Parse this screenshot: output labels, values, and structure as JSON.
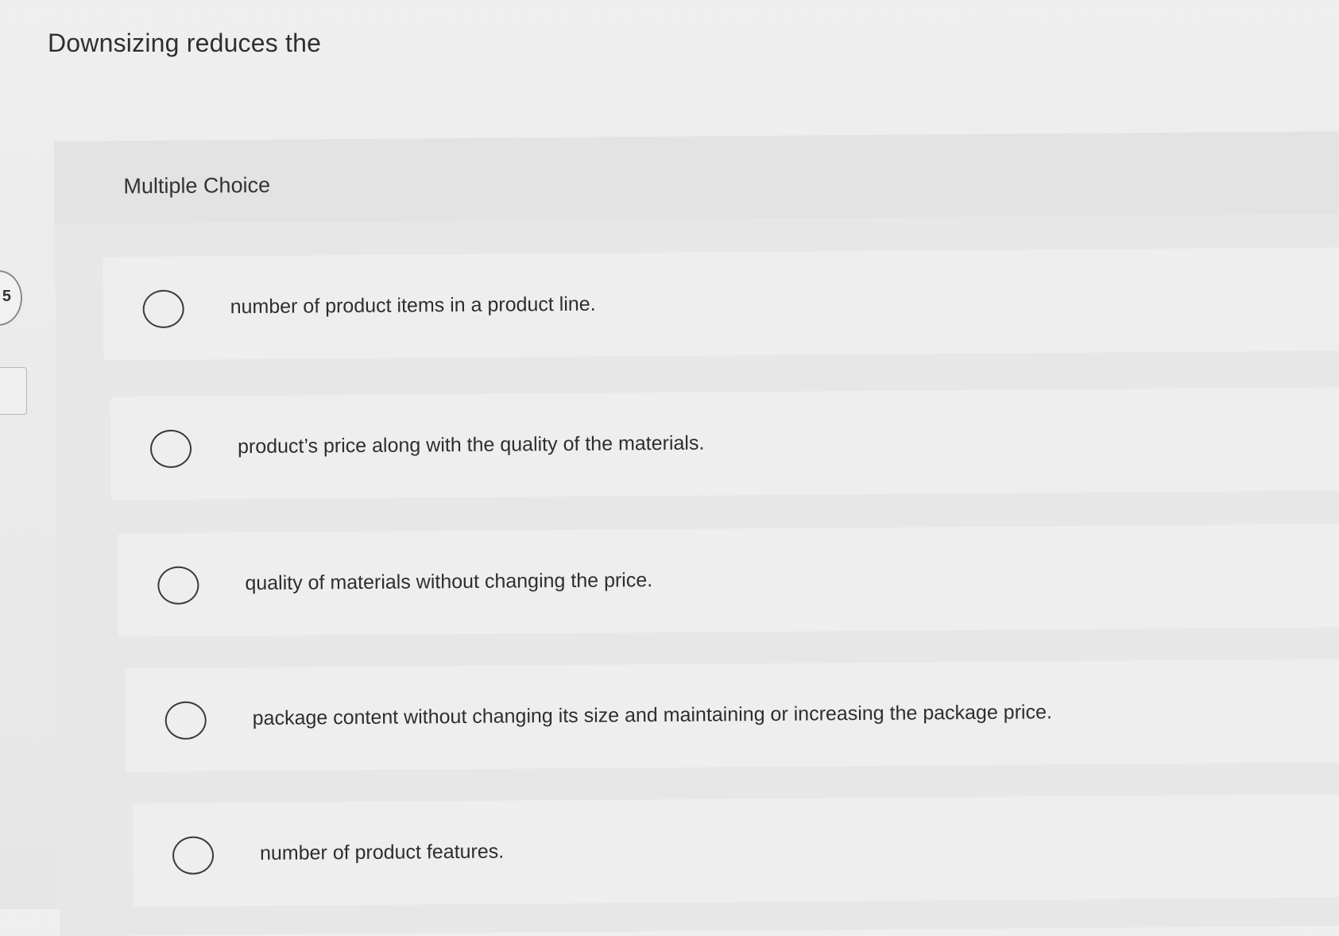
{
  "question": {
    "text": "Downsizing reduces the"
  },
  "side_badge": {
    "label": "5"
  },
  "section": {
    "title": "Multiple Choice"
  },
  "options": [
    {
      "label": "number of product items in a product line."
    },
    {
      "label": "product’s price along with the quality of the materials."
    },
    {
      "label": "quality of materials without changing the price."
    },
    {
      "label": "package content without changing its size and maintaining or increasing the package price."
    },
    {
      "label": "number of product features."
    }
  ]
}
